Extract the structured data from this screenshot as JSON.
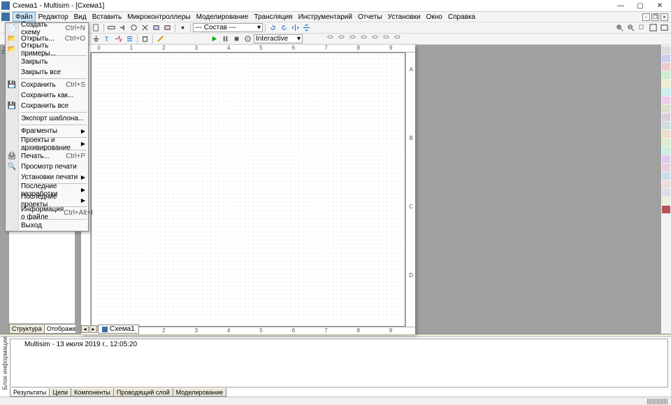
{
  "window": {
    "title": "Схема1 - Multisim - [Схема1]",
    "min": "—",
    "max": "▢",
    "close": "✕"
  },
  "menu": {
    "items": [
      "Файл",
      "Редактор",
      "Вид",
      "Вставить",
      "Микроконтроллеры",
      "Моделирование",
      "Трансляция",
      "Инструментарий",
      "Отчеты",
      "Установки",
      "Окно",
      "Справка"
    ]
  },
  "toolbar2": {
    "combo": "--- Состав ---",
    "interactive": "Interactive"
  },
  "filemenu": {
    "new": "Создать схему",
    "new_sc": "Ctrl+N",
    "open": "Открыть...",
    "open_sc": "Ctrl+O",
    "examples": "Открыть примеры...",
    "close": "Закрыть",
    "closeall": "Закрыть все",
    "save": "Сохранить",
    "save_sc": "Ctrl+S",
    "saveas": "Сохранить как...",
    "saveall": "Сохранить все",
    "export": "Экспорт шаблона...",
    "fragments": "Фрагменты",
    "projects": "Проекты и архивирование",
    "print": "Печать...",
    "print_sc": "Ctrl+P",
    "preview": "Просмотр печати",
    "printsetup": "Установки печати",
    "recent_dev": "Последние разработки",
    "recent_proj": "Последние проекты",
    "info": "Информация о файле",
    "info_sc": "Ctrl+Alt+I",
    "exit": "Выход"
  },
  "left_tabs": {
    "t1": "Структура",
    "t2": "Отображение"
  },
  "doc_tab": "Схема1",
  "ruler": {
    "n0": "0",
    "n1": "1",
    "n2": "2",
    "n3": "3",
    "n4": "4",
    "n5": "5",
    "n6": "6",
    "n7": "7",
    "n8": "8",
    "n9": "9"
  },
  "vruler": {
    "a": "A",
    "b": "B",
    "c": "C",
    "d": "D"
  },
  "log": {
    "text": "Multisim  -  13 июля 2019 г., 12:05:20"
  },
  "bottom_tabs": {
    "t1": "Результаты",
    "t2": "Цепи",
    "t3": "Компоненты",
    "t4": "Проводящий слой",
    "t5": "Моделирование"
  },
  "side_labels": {
    "panel": "Па",
    "info": "Блок информации"
  }
}
